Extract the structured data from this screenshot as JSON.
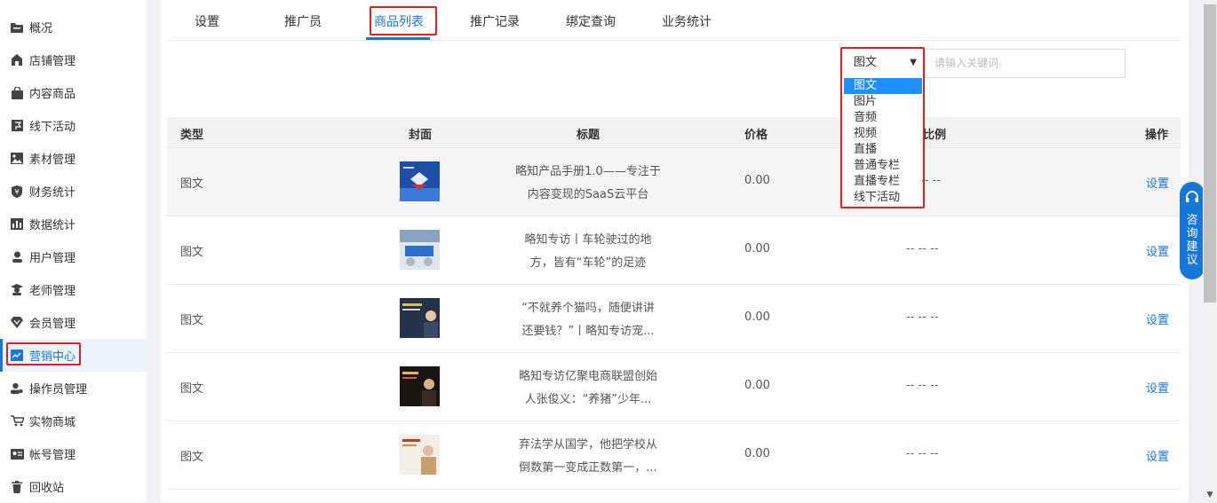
{
  "sidebar": {
    "items": [
      {
        "label": "概况",
        "icon": "folder-icon"
      },
      {
        "label": "店铺管理",
        "icon": "shop-icon"
      },
      {
        "label": "内容商品",
        "icon": "bag-icon"
      },
      {
        "label": "线下活动",
        "icon": "flag-icon"
      },
      {
        "label": "素材管理",
        "icon": "image-icon"
      },
      {
        "label": "财务统计",
        "icon": "money-icon"
      },
      {
        "label": "数据统计",
        "icon": "bar-chart-icon"
      },
      {
        "label": "用户管理",
        "icon": "user-icon"
      },
      {
        "label": "老师管理",
        "icon": "teacher-icon"
      },
      {
        "label": "会员管理",
        "icon": "vip-icon"
      },
      {
        "label": "营销中心",
        "icon": "marketing-icon"
      },
      {
        "label": "操作员管理",
        "icon": "operator-icon"
      },
      {
        "label": "实物商城",
        "icon": "cart-icon"
      },
      {
        "label": "帐号管理",
        "icon": "id-card-icon"
      },
      {
        "label": "回收站",
        "icon": "trash-icon"
      }
    ],
    "active_index": 10
  },
  "tabs": [
    "设置",
    "推广员",
    "商品列表",
    "推广记录",
    "绑定查询",
    "业务统计"
  ],
  "active_tab": 2,
  "filter": {
    "selected": "图文",
    "options": [
      "图文",
      "图片",
      "音频",
      "视频",
      "直播",
      "普通专栏",
      "直播专栏",
      "线下活动"
    ],
    "search_placeholder": "请输入关键词"
  },
  "table": {
    "headers": {
      "type": "类型",
      "cover": "封面",
      "title": "标题",
      "price": "价格",
      "ratio": "比例",
      "op": "操作"
    },
    "rows": [
      {
        "type": "图文",
        "title_line1": "略知产品手册1.0——专注于",
        "title_line2": "内容变现的SaaS云平台",
        "price": "0.00",
        "ratio": "-- --",
        "op": "设置"
      },
      {
        "type": "图文",
        "title_line1": "略知专访丨车轮驶过的地",
        "title_line2": "方，皆有“车轮”的足迹",
        "price": "0.00",
        "ratio": "-- -- --",
        "op": "设置"
      },
      {
        "type": "图文",
        "title_line1": "“不就养个猫吗，随便讲讲",
        "title_line2": "还要钱？”丨略知专访宠...",
        "price": "0.00",
        "ratio": "-- -- --",
        "op": "设置"
      },
      {
        "type": "图文",
        "title_line1": "略知专访亿聚电商联盟创始",
        "title_line2": "人张俊义：“养猪”少年...",
        "price": "0.00",
        "ratio": "-- -- --",
        "op": "设置"
      },
      {
        "type": "图文",
        "title_line1": "弃法学从国学，他把学校从",
        "title_line2": "倒数第一变成正数第一，...",
        "price": "0.00",
        "ratio": "-- -- --",
        "op": "设置"
      }
    ]
  },
  "consult": {
    "label": "咨询建议"
  },
  "colors": {
    "accent": "#1677d9",
    "highlight_border": "#e02020",
    "dropdown_selected": "#1e90ff"
  }
}
